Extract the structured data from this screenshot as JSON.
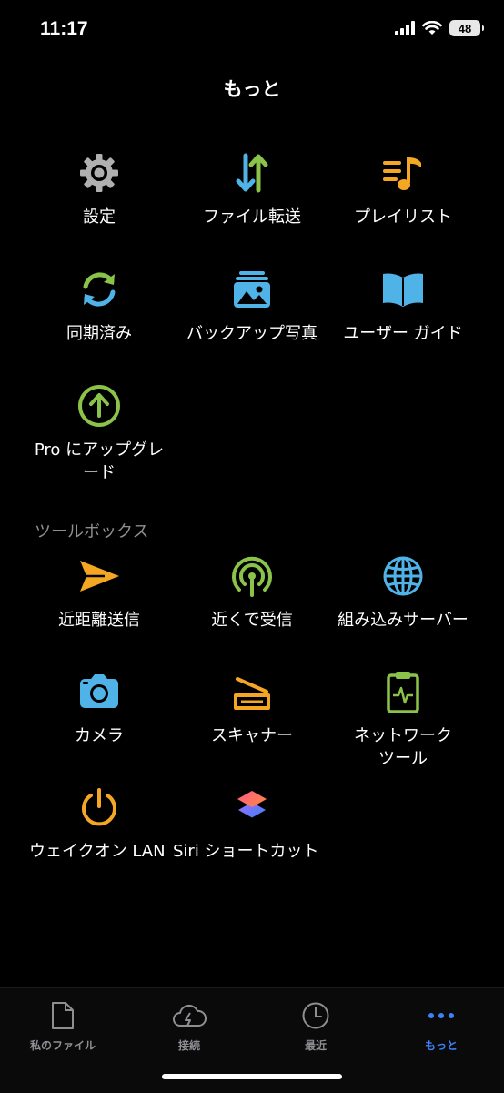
{
  "status": {
    "time": "11:17",
    "battery": "48"
  },
  "page": {
    "title": "もっと"
  },
  "grid1": {
    "settings": "設定",
    "file_transfer": "ファイル転送",
    "playlist": "プレイリスト",
    "synced": "同期済み",
    "backup_photos": "バックアップ写真",
    "user_guide": "ユーザー ガイド",
    "upgrade_line1": "Pro にアップグレ",
    "upgrade_line2": "ード"
  },
  "toolbox": {
    "header": "ツールボックス",
    "nearby_send": "近距離送信",
    "nearby_receive": "近くで受信",
    "embedded_server": "組み込みサーバー",
    "camera": "カメラ",
    "scanner": "スキャナー",
    "network_tools_line1": "ネットワーク",
    "network_tools_line2": "ツール",
    "wake_on_lan": "ウェイクオン LAN",
    "siri_shortcuts": "Siri ショートカット"
  },
  "tabs": {
    "my_files": "私のファイル",
    "connect": "接続",
    "recent": "最近",
    "more": "もっと"
  },
  "colors": {
    "active_tab": "#3b82f6",
    "blue_icon": "#4fb3e8",
    "green_icon": "#8bc34a",
    "orange_icon": "#f5a623",
    "gray_icon": "#b0b0b0"
  }
}
